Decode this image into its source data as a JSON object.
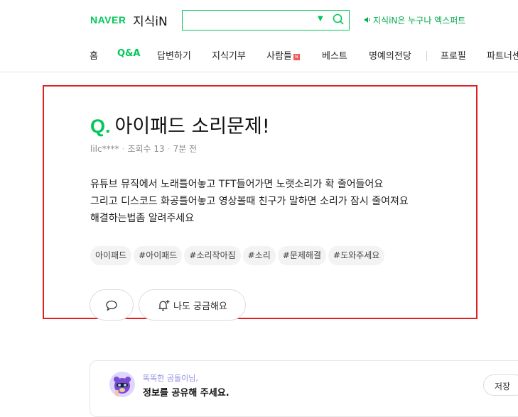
{
  "header": {
    "brand": "NAVER",
    "service": "지식iN",
    "notice": "지식iN은 누구나 엑스퍼트",
    "search": {
      "value": "",
      "placeholder": ""
    }
  },
  "nav": {
    "items": [
      {
        "label": "홈"
      },
      {
        "label": "Q&A",
        "active": true
      },
      {
        "label": "답변하기"
      },
      {
        "label": "지식기부"
      },
      {
        "label": "사람들",
        "badge": "N"
      },
      {
        "label": "베스트"
      },
      {
        "label": "명예의전당"
      },
      {
        "label": "프로필"
      },
      {
        "label": "파트너센"
      }
    ]
  },
  "question": {
    "q_mark": "Q.",
    "title": "아이패드 소리문제!",
    "author": "lilc****",
    "views": "조회수 13",
    "time": "7분 전",
    "body": [
      "유튜브 뮤직에서 노래틀어놓고 TFT들어가면 노랫소리가 확 줄어들어요",
      "그리고 디스코드 화공틀어놓고 영상볼때 친구가 말하면 소리가 잠시 줄여져요",
      "해결하는법좀 알려주세요"
    ],
    "tags": [
      "아이패드",
      "#아이패드",
      "#소리작아짐",
      "#소리",
      "#문제해결",
      "#도와주세요"
    ],
    "curious_label": "나도 궁금해요"
  },
  "answer_box": {
    "hint": "똑똑한 곰돌이님,",
    "prompt": "정보를 공유해 주세요.",
    "save_label": "저장"
  },
  "colors": {
    "brand_green": "#03c75a",
    "highlight_red": "#e02020"
  }
}
